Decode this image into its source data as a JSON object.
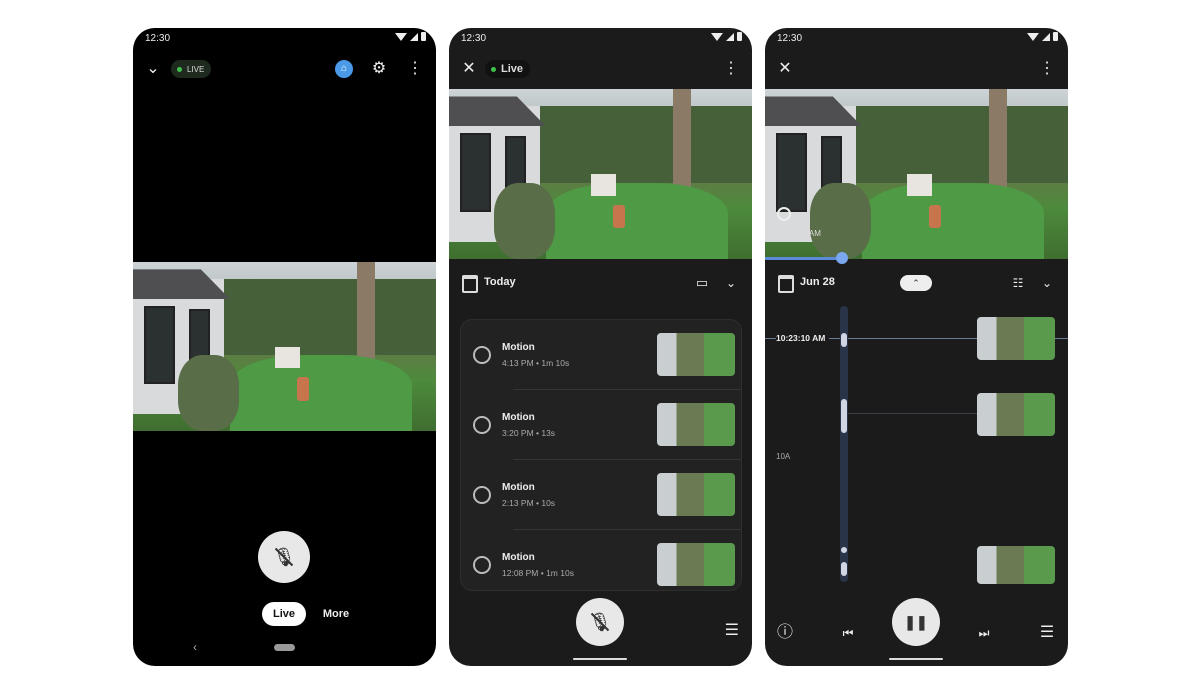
{
  "phone1": {
    "status_time": "12:30",
    "live_badge": "LIVE",
    "home_icon": "home-icon",
    "settings_icon": "gear-icon",
    "menu_icon": "more-vert-icon",
    "collapse_icon": "chevron-down-icon",
    "mic_icon": "mic-off-icon",
    "tabs": [
      {
        "label": "Live",
        "active": true
      },
      {
        "label": "More",
        "active": false
      }
    ],
    "nav_back": "‹"
  },
  "phone2": {
    "status_time": "12:30",
    "live_badge": "Live",
    "close_icon": "close-icon",
    "menu_icon": "more-vert-icon",
    "date_label": "Today",
    "events": [
      {
        "title": "Motion",
        "detail": "4:13 PM • 1m 10s"
      },
      {
        "title": "Motion",
        "detail": "3:20 PM • 13s"
      },
      {
        "title": "Motion",
        "detail": "2:13 PM • 10s"
      },
      {
        "title": "Motion",
        "detail": "12:08 PM • 1m 10s"
      }
    ],
    "mic_icon": "mic-off-icon",
    "list_icon": "menu-icon"
  },
  "phone3": {
    "status_time": "12:30",
    "close_icon": "close-icon",
    "menu_icon": "more-vert-icon",
    "overlay_time": "10:23:10 AM",
    "date_label": "Jun 28",
    "cursor_time": "10:23:10 AM",
    "hour_label": "10A",
    "accent": "#5a8ad8",
    "playback_icons": [
      "info-icon",
      "skip-previous-icon",
      "pause-icon",
      "skip-next-icon",
      "menu-icon"
    ]
  }
}
